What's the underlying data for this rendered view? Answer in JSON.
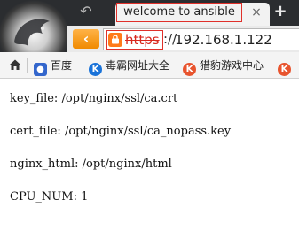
{
  "tab": {
    "title": "welcome to ansible",
    "close": "×",
    "new_tab": "+"
  },
  "nav": {
    "back_arrow": "↶",
    "back_button": "‹"
  },
  "address": {
    "scheme": "https",
    "separator": "://",
    "host": "192.168.1.122"
  },
  "bookmarks": [
    {
      "label": "百度",
      "icon": "baidu-paw-icon",
      "color": "#3366cc"
    },
    {
      "label": "毒霸网址大全",
      "icon": "kingsoft-k-icon",
      "color": "#1a73d9"
    },
    {
      "label": "猎豹游戏中心",
      "icon": "liebao-k-icon",
      "color": "#e8542e"
    },
    {
      "label": "",
      "icon": "liebao-k-icon",
      "color": "#e8542e"
    }
  ],
  "content": {
    "lines": [
      "key_file: /opt/nginx/ssl/ca.crt",
      "cert_file: /opt/nginx/ssl/ca_nopass.key",
      "nginx_html: /opt/nginx/html",
      "CPU_NUM: 1"
    ]
  },
  "colors": {
    "annotation_red": "#e0302a",
    "chrome_dark": "#2b2d30",
    "accent_orange": "#f08a00"
  }
}
